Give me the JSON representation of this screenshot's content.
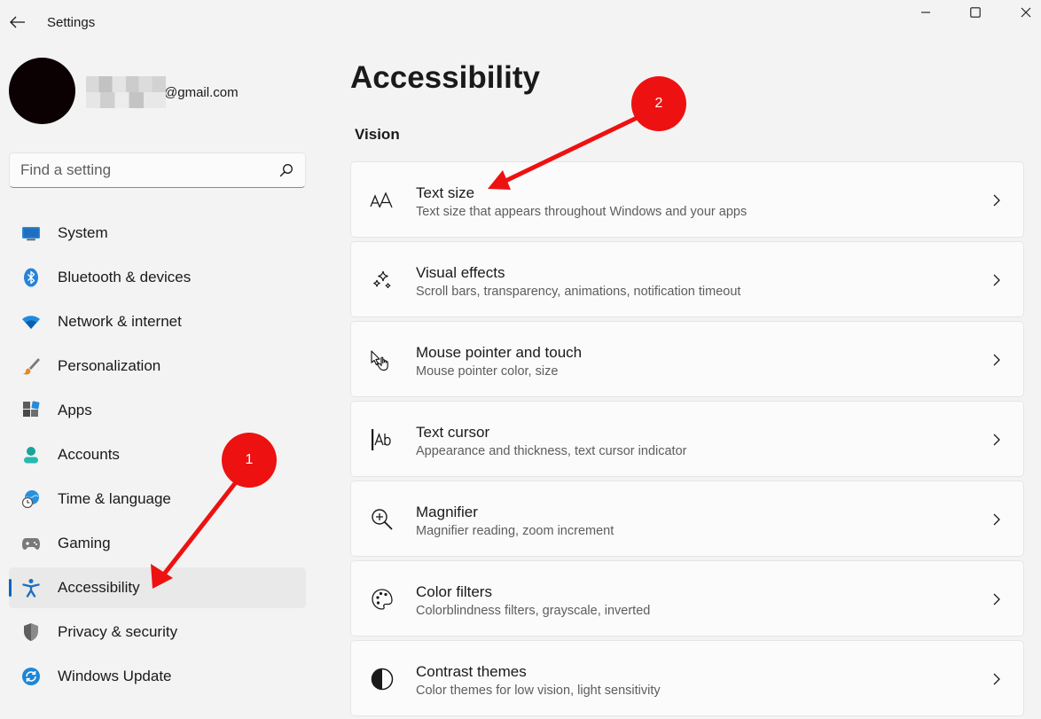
{
  "window": {
    "title": "Settings",
    "controls": [
      "minimize",
      "maximize",
      "close"
    ]
  },
  "profile": {
    "email_suffix": "@gmail.com"
  },
  "search": {
    "placeholder": "Find a setting"
  },
  "sidebar": {
    "items": [
      {
        "label": "System",
        "icon": "system-icon",
        "selected": false
      },
      {
        "label": "Bluetooth & devices",
        "icon": "bluetooth-icon",
        "selected": false
      },
      {
        "label": "Network & internet",
        "icon": "wifi-icon",
        "selected": false
      },
      {
        "label": "Personalization",
        "icon": "brush-icon",
        "selected": false
      },
      {
        "label": "Apps",
        "icon": "apps-icon",
        "selected": false
      },
      {
        "label": "Accounts",
        "icon": "accounts-icon",
        "selected": false
      },
      {
        "label": "Time & language",
        "icon": "time-language-icon",
        "selected": false
      },
      {
        "label": "Gaming",
        "icon": "gamepad-icon",
        "selected": false
      },
      {
        "label": "Accessibility",
        "icon": "accessibility-icon",
        "selected": true
      },
      {
        "label": "Privacy & security",
        "icon": "shield-icon",
        "selected": false
      },
      {
        "label": "Windows Update",
        "icon": "update-icon",
        "selected": false
      }
    ]
  },
  "main": {
    "title": "Accessibility",
    "section": "Vision",
    "cards": [
      {
        "title": "Text size",
        "subtitle": "Text size that appears throughout Windows and your apps",
        "icon": "text-size-icon"
      },
      {
        "title": "Visual effects",
        "subtitle": "Scroll bars, transparency, animations, notification timeout",
        "icon": "sparkle-icon"
      },
      {
        "title": "Mouse pointer and touch",
        "subtitle": "Mouse pointer color, size",
        "icon": "pointer-icon"
      },
      {
        "title": "Text cursor",
        "subtitle": "Appearance and thickness, text cursor indicator",
        "icon": "text-cursor-icon"
      },
      {
        "title": "Magnifier",
        "subtitle": "Magnifier reading, zoom increment",
        "icon": "magnifier-icon"
      },
      {
        "title": "Color filters",
        "subtitle": "Colorblindness filters, grayscale, inverted",
        "icon": "palette-icon"
      },
      {
        "title": "Contrast themes",
        "subtitle": "Color themes for low vision, light sensitivity",
        "icon": "contrast-icon"
      }
    ]
  },
  "annotations": {
    "step1": "1",
    "step2": "2",
    "color": "#ee1111"
  },
  "colors": {
    "accent": "#0067c0",
    "background": "#f3f3f3",
    "card": "#fbfbfb"
  }
}
